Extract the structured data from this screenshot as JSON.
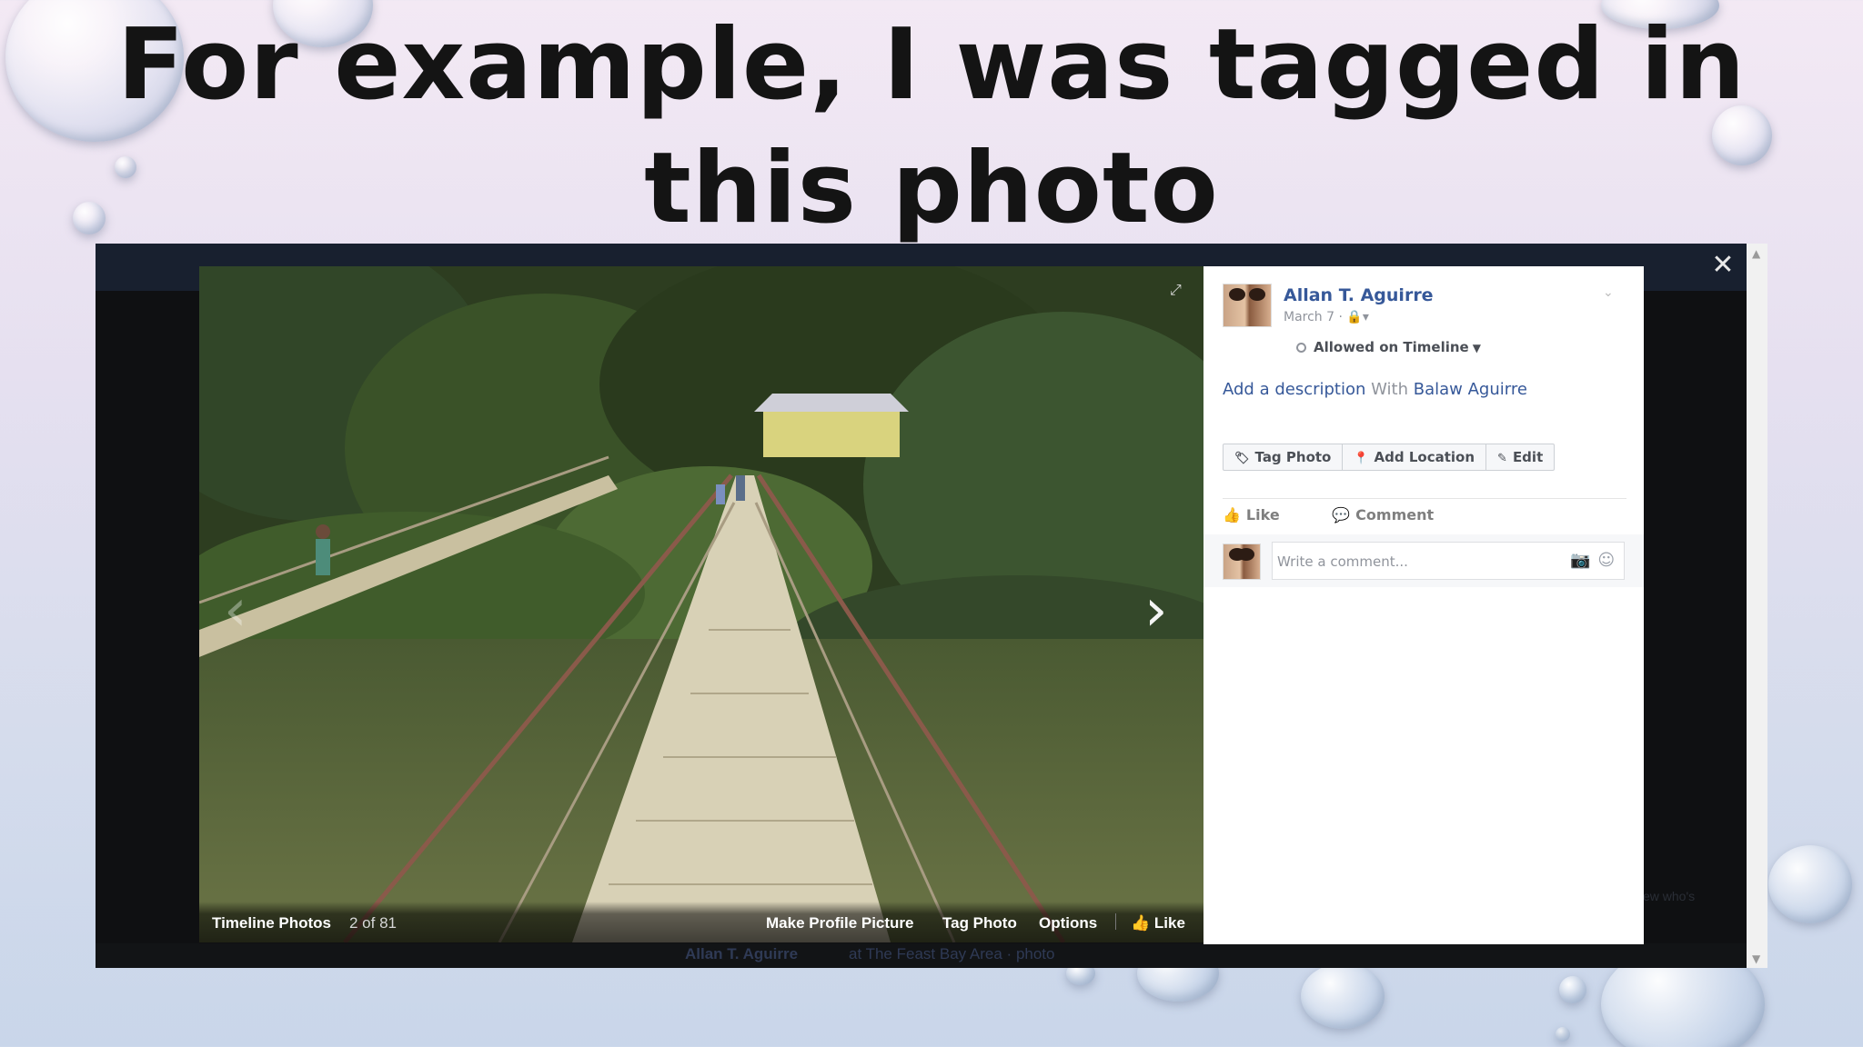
{
  "slide": {
    "title": "For example, I was tagged in this photo"
  },
  "viewer": {
    "close_label": "✕",
    "prev_label": "‹",
    "next_label": "›",
    "photo_bar": {
      "album": "Timeline Photos",
      "position": "2 of 81",
      "make_profile": "Make Profile Picture",
      "tag_photo": "Tag Photo",
      "options": "Options",
      "like": "Like"
    },
    "background_post": {
      "author": "Allan T. Aguirre",
      "text": "at The Feast Bay Area · photo",
      "ghost_text": "ew who's"
    }
  },
  "panel": {
    "author": "Allan T. Aguirre",
    "date": "March 7",
    "audience": "Allowed on Timeline",
    "description_link": "Add a description",
    "with_label": "With",
    "tagged_person": "Balaw Aguirre",
    "buttons": {
      "tag_photo": "Tag Photo",
      "add_location": "Add Location",
      "edit": "Edit"
    },
    "actions": {
      "like": "Like",
      "comment": "Comment"
    },
    "comment_placeholder": "Write a comment..."
  },
  "colors": {
    "link": "#365899",
    "muted": "#90949c",
    "overlay": "#0f1012"
  },
  "icons": [
    "close-icon",
    "chevron-left-icon",
    "chevron-right-icon",
    "expand-icon",
    "thumbs-up-icon",
    "tag-icon",
    "location-pin-icon",
    "pencil-icon",
    "comment-icon",
    "camera-icon",
    "smiley-icon",
    "lock-icon",
    "caret-down-icon"
  ]
}
